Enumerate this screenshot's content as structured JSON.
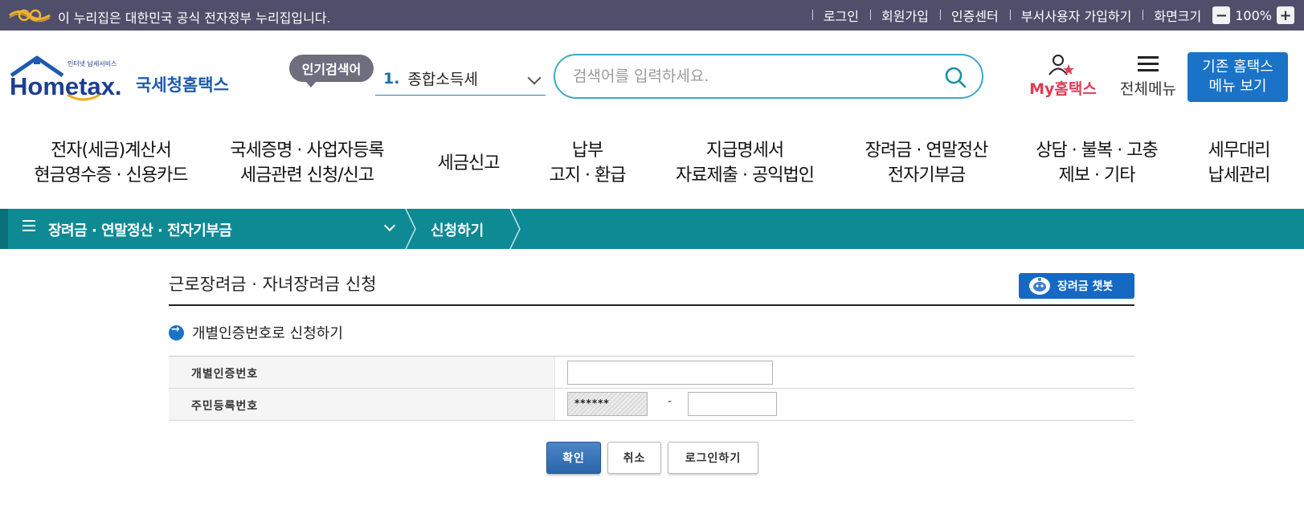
{
  "gov_bar": {
    "notice": "이 누리집은 대한민국 공식 전자정부 누리집입니다.",
    "links": [
      "로그인",
      "회원가입",
      "인증센터",
      "부서사용자 가입하기",
      "화면크기"
    ],
    "zoom_level": "100%",
    "zoom_minus": "−",
    "zoom_plus": "+"
  },
  "header": {
    "logo_small": "인터넷 납세서비스",
    "logo_text": "Hometax.",
    "logo_korean": "국세청홈택스",
    "popular_badge": "인기검색어",
    "popular_rank": "1.",
    "popular_term": "종합소득세",
    "search_placeholder": "검색어를 입력하세요.",
    "my_hometax": "My홈택스",
    "all_menu": "전체메뉴",
    "old_hometax": "기존 홈택스\n메뉴 보기"
  },
  "main_nav": [
    {
      "label": "전자(세금)계산서\n현금영수증 · 신용카드"
    },
    {
      "label": "국세증명 · 사업자등록\n세금관련 신청/신고"
    },
    {
      "label": "세금신고"
    },
    {
      "label": "납부\n고지 · 환급"
    },
    {
      "label": "지급명세서\n자료제출 · 공익법인"
    },
    {
      "label": "장려금 · 연말정산\n전자기부금"
    },
    {
      "label": "상담 · 불복 · 고충\n제보 · 기타"
    },
    {
      "label": "세무대리\n납세관리"
    }
  ],
  "breadcrumb": {
    "level1": "장려금 · 연말정산 · 전자기부금",
    "level2": "신청하기"
  },
  "page": {
    "title": "근로장려금 · 자녀장려금 신청",
    "chatbot_label": "장려금 챗봇",
    "section_title": "개별인증번호로 신청하기",
    "fields": {
      "auth_label": "개별인증번호",
      "auth_value": "",
      "rrn_label": "주민등록번호",
      "rrn_front_masked": "******",
      "rrn_separator": "-",
      "rrn_back_value": ""
    },
    "buttons": {
      "confirm": "확인",
      "cancel": "취소",
      "login": "로그인하기"
    }
  },
  "colors": {
    "gov_bar": "#4f4f6b",
    "breadcrumb_bar": "#0e8a95",
    "accent_blue": "#1a73c7",
    "search_border": "#3ba9c6",
    "my_hometax": "#e03a57"
  }
}
